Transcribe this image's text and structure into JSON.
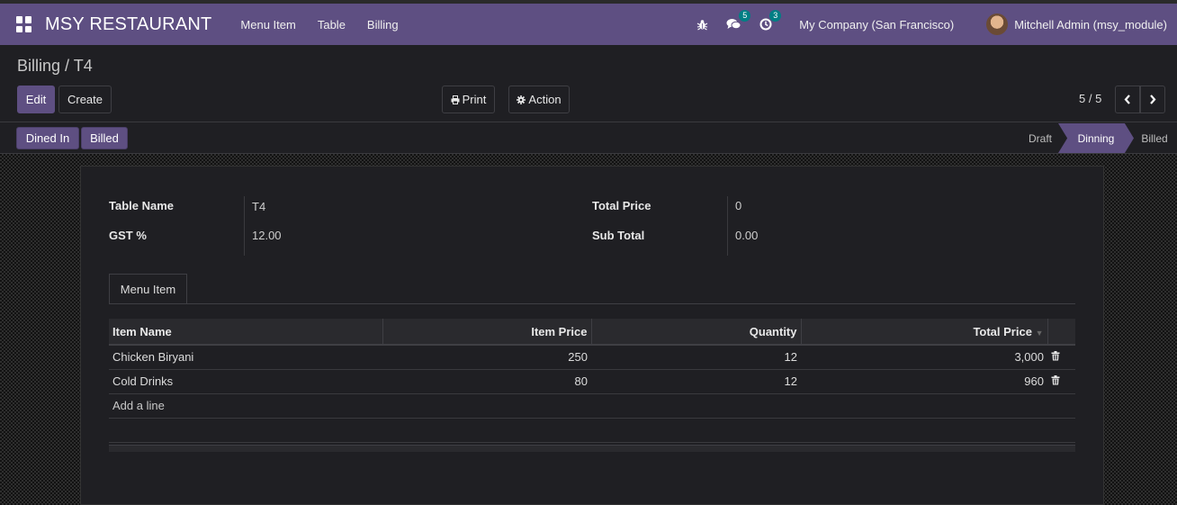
{
  "navbar": {
    "brand": "MSY RESTAURANT",
    "menu": [
      "Menu Item",
      "Table",
      "Billing"
    ],
    "messages_count": "5",
    "activities_count": "3",
    "company": "My Company (San Francisco)",
    "user": "Mitchell Admin (msy_module)"
  },
  "breadcrumb": "Billing / T4",
  "toolbar": {
    "edit": "Edit",
    "create": "Create",
    "print": "Print",
    "action": "Action",
    "pager": "5 / 5"
  },
  "statusbar": {
    "buttons": [
      "Dined In",
      "Billed"
    ],
    "stages": [
      "Draft",
      "Dinning",
      "Billed"
    ],
    "active_stage": "Dinning"
  },
  "form": {
    "table_name_label": "Table Name",
    "table_name": "T4",
    "gst_label": "GST %",
    "gst": "12.00",
    "total_price_label": "Total Price",
    "total_price": "0",
    "sub_total_label": "Sub Total",
    "sub_total": "0.00"
  },
  "notebook": {
    "tab": "Menu Item",
    "columns": [
      "Item Name",
      "Item Price",
      "Quantity",
      "Total Price"
    ],
    "rows": [
      {
        "item": "Chicken Biryani",
        "price": "250",
        "qty": "12",
        "total": "3,000"
      },
      {
        "item": "Cold Drinks",
        "price": "80",
        "qty": "12",
        "total": "960"
      }
    ],
    "add_line": "Add a line"
  },
  "colors": {
    "primary": "#5e4f82",
    "badge": "#017e84"
  }
}
